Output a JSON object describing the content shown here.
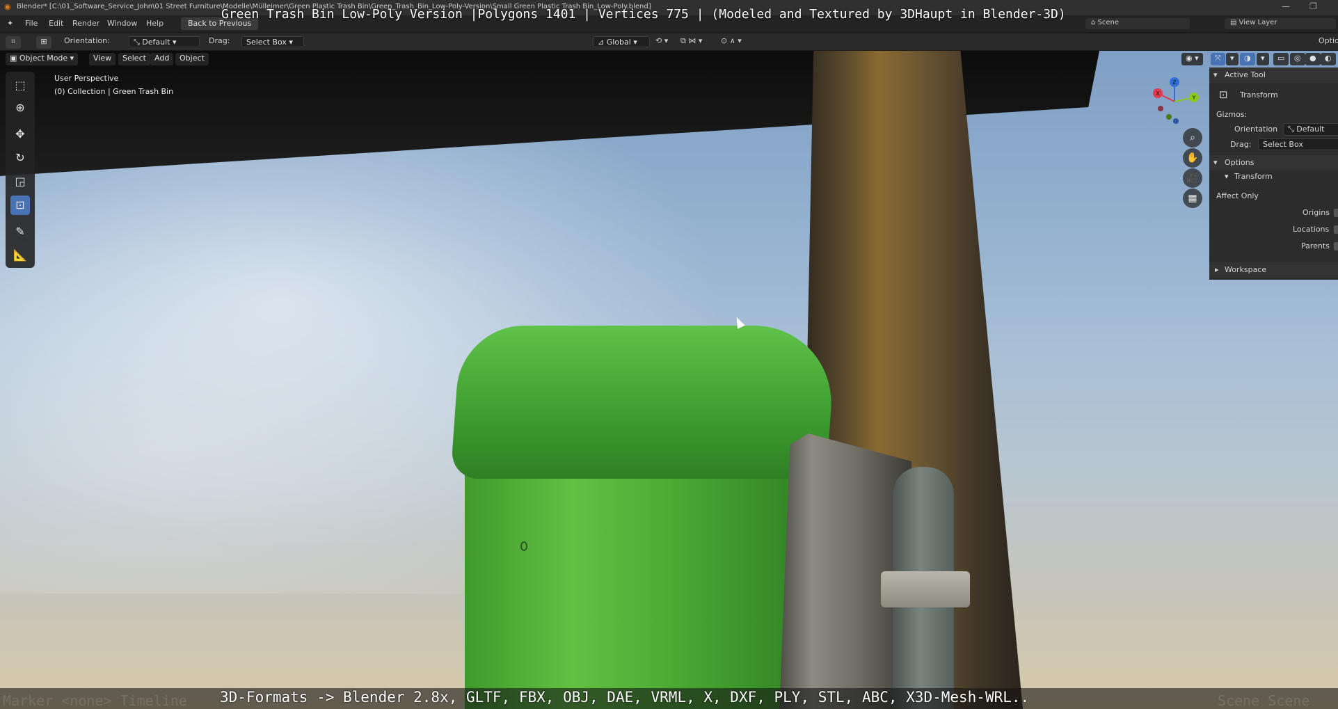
{
  "window": {
    "title_path": "Blender* [C:\\01_Software_Service_John\\01 Street Furniture\\Modelle\\Mülleimer\\Green Plastic Trash Bin\\Green_Trash_Bin_Low-Poly-Version\\Small Green Plastic Trash Bin_Low-Poly.blend]",
    "minimize": "—",
    "maximize": "❐"
  },
  "menubar": {
    "items": [
      "File",
      "Edit",
      "Render",
      "Window",
      "Help"
    ],
    "workspace_tab": "Back to Previous",
    "scene_label": "Scene",
    "view_layer_label": "View Layer"
  },
  "overlay": {
    "top_caption": "Green Trash Bin Low-Poly Version |Polygons 1401 | Vertices 775 | (Modeled and Textured by 3DHaupt in Blender-3D)",
    "bottom_caption": "3D-Formats -> Blender 2.8x, GLTF, FBX, OBJ, DAE, VRML, X, DXF, PLY, STL, ABC, X3D-Mesh-WRL..",
    "faint_left": "Marker <none>   Timeline",
    "faint_right": "Scene Scene"
  },
  "tool_header": {
    "orientation_label": "Orientation:",
    "orientation_value": "Default",
    "drag_label": "Drag:",
    "drag_value": "Select Box",
    "transform_orientation": "Global",
    "options_label": "Optio"
  },
  "viewport_header": {
    "mode": "Object Mode",
    "menus": [
      "View",
      "Select",
      "Add",
      "Object"
    ]
  },
  "viewport_info": {
    "perspective": "User Perspective",
    "collection": "(0) Collection | Green Trash Bin"
  },
  "gizmo": {
    "x": "X",
    "y": "Y",
    "z": "Z"
  },
  "sidebar": {
    "active_tool_header": "Active Tool",
    "tool_name": "Transform",
    "gizmos_label": "Gizmos:",
    "orientation_label": "Orientation",
    "orientation_value": "Default",
    "drag_label": "Drag:",
    "drag_value": "Select Box",
    "options_header": "Options",
    "transform_sub": "Transform",
    "affect_only": "Affect Only",
    "origins": "Origins",
    "locations": "Locations",
    "parents": "Parents",
    "workspace_header": "Workspace"
  },
  "colors": {
    "accent": "#4772b3",
    "panel": "#2c2c2c",
    "bin_green": "#4aa733"
  }
}
